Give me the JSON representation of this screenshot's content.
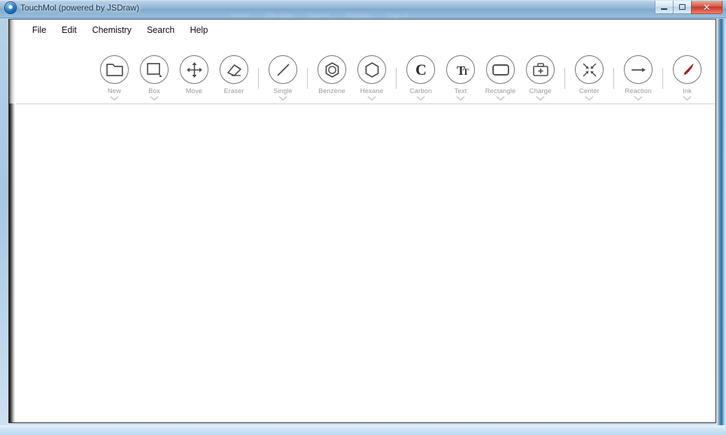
{
  "window": {
    "title": "TouchMol (powered by JSDraw)",
    "app_icon": "molecule-icon",
    "controls": {
      "minimize": "minimize-button",
      "restore": "restore-button",
      "close_glyph": "✕"
    },
    "ghost_text": [
      "Home",
      "Site Map",
      "Search",
      "Register",
      "Sign In"
    ]
  },
  "menu": {
    "items": [
      {
        "label": "File"
      },
      {
        "label": "Edit"
      },
      {
        "label": "Chemistry"
      },
      {
        "label": "Search"
      },
      {
        "label": "Help"
      }
    ]
  },
  "toolbar": {
    "groups": [
      {
        "tools": [
          {
            "label": "New",
            "icon": "folder-icon",
            "chevron": true
          },
          {
            "label": "Box",
            "icon": "box-icon",
            "chevron": true
          },
          {
            "label": "Move",
            "icon": "move-arrows-icon",
            "chevron": false
          },
          {
            "label": "Eraser",
            "icon": "eraser-icon",
            "chevron": false
          }
        ]
      },
      {
        "tools": [
          {
            "label": "Single",
            "icon": "single-bond-icon",
            "chevron": true
          }
        ]
      },
      {
        "tools": [
          {
            "label": "Benzene",
            "icon": "benzene-ring-icon",
            "chevron": false
          },
          {
            "label": "Hexane",
            "icon": "hexagon-icon",
            "chevron": true
          }
        ]
      },
      {
        "tools": [
          {
            "label": "Carbon",
            "icon": "carbon-atom-icon",
            "chevron": true
          },
          {
            "label": "Text",
            "icon": "text-tt-icon",
            "chevron": true
          },
          {
            "label": "Rectangle",
            "icon": "rectangle-icon",
            "chevron": true
          },
          {
            "label": "Charge",
            "icon": "charge-battery-icon",
            "chevron": true
          }
        ]
      },
      {
        "tools": [
          {
            "label": "Center",
            "icon": "center-arrows-icon",
            "chevron": true
          }
        ]
      },
      {
        "tools": [
          {
            "label": "Reaction",
            "icon": "reaction-arrow-icon",
            "chevron": true
          }
        ]
      },
      {
        "tools": [
          {
            "label": "Ink",
            "icon": "ink-brush-icon",
            "chevron": true
          }
        ]
      }
    ]
  },
  "colors": {
    "icon_stroke": "#4a4a4a",
    "label": "#9a9a9a",
    "ink_red": "#a81f1f",
    "titlebar_blue": "#8fb4d4",
    "close_red": "#c43a27"
  },
  "canvas": {
    "content": ""
  }
}
